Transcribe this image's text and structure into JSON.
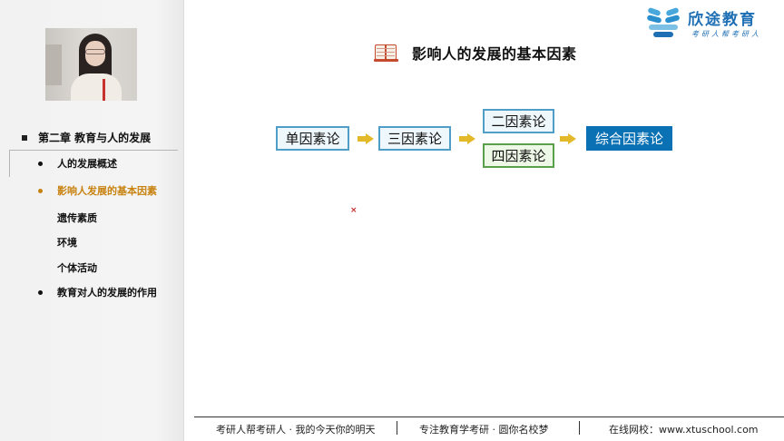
{
  "sidebar": {
    "chapter_title": "第二章  教育与人的发展",
    "items": [
      {
        "label": "人的发展概述"
      },
      {
        "label": "影响人发展的基本因素"
      },
      {
        "label": "教育对人的发展的作用"
      }
    ],
    "subitems": [
      {
        "label": "遗传素质"
      },
      {
        "label": "环境"
      },
      {
        "label": "个体活动"
      }
    ]
  },
  "main": {
    "title": "影响人的发展的基本因素",
    "title_icon": "book-icon",
    "diagram": {
      "nodes": [
        "单因素论",
        "三因素论",
        "二因素论",
        "四因素论",
        "综合因素论"
      ],
      "arrow_icon": "right-arrow-icon"
    },
    "cursor_mark": "×"
  },
  "logo": {
    "name": "欣途教育",
    "slogan": "考研人帮考研人"
  },
  "footer": {
    "left": "考研人帮考研人 · 我的今天你的明天",
    "center": "专注教育学考研 · 圆你名校梦",
    "right": "在线网校：www.xtuschool.com"
  },
  "colors": {
    "accent_active": "#c8820f",
    "box_blue_border": "#4f9ec8",
    "box_green_border": "#5aa04a",
    "box_dark_fill": "#0a71b5",
    "arrow": "#e3b92a",
    "brand": "#1f6fb5"
  }
}
